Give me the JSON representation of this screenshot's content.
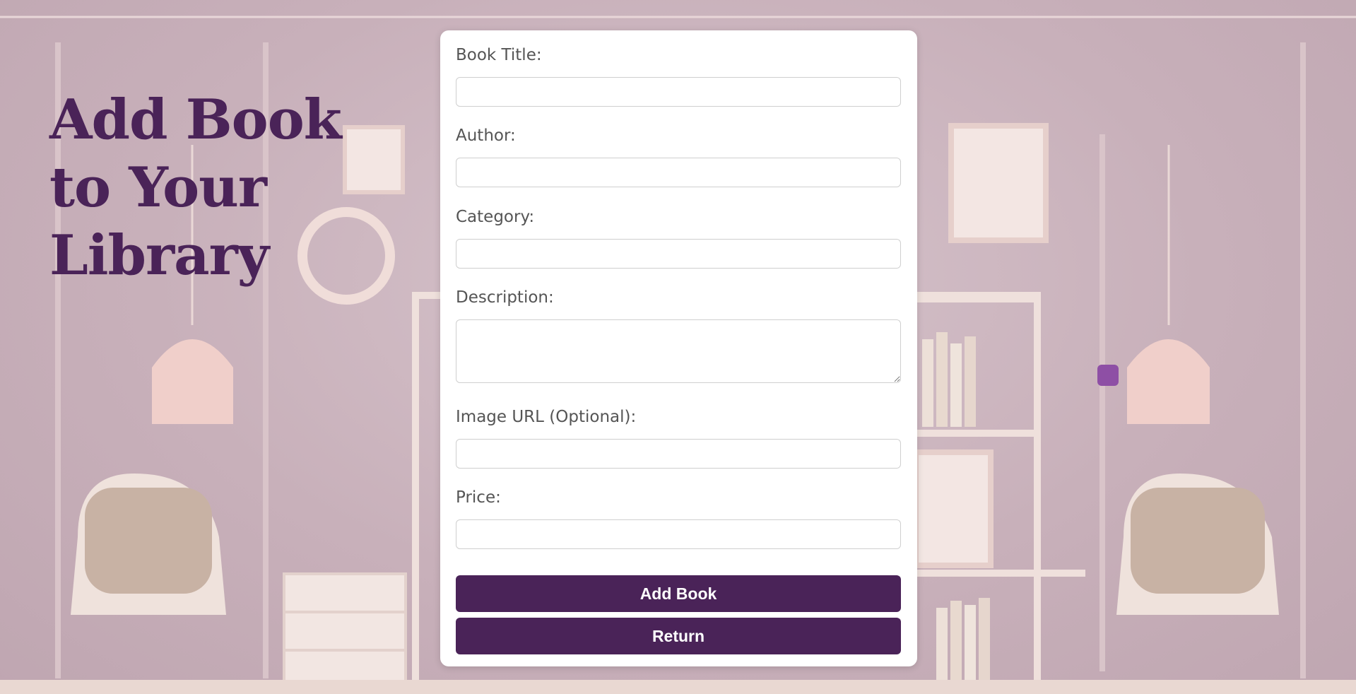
{
  "page": {
    "heading": "Add Book to Your Library"
  },
  "form": {
    "fields": [
      {
        "label": "Book Title:",
        "value": "",
        "placeholder": ""
      },
      {
        "label": "Author:",
        "value": "",
        "placeholder": ""
      },
      {
        "label": "Category:",
        "value": "",
        "placeholder": ""
      },
      {
        "label": "Description:",
        "value": "",
        "placeholder": ""
      },
      {
        "label": "Image URL (Optional):",
        "value": "",
        "placeholder": ""
      },
      {
        "label": "Price:",
        "value": "",
        "placeholder": ""
      }
    ],
    "add_button": "Add Book",
    "return_button": "Return"
  },
  "colors": {
    "accent": "#4a2358",
    "accent_dot": "#8e4fa5",
    "background": "#c9b3bd",
    "card": "#ffffff"
  }
}
